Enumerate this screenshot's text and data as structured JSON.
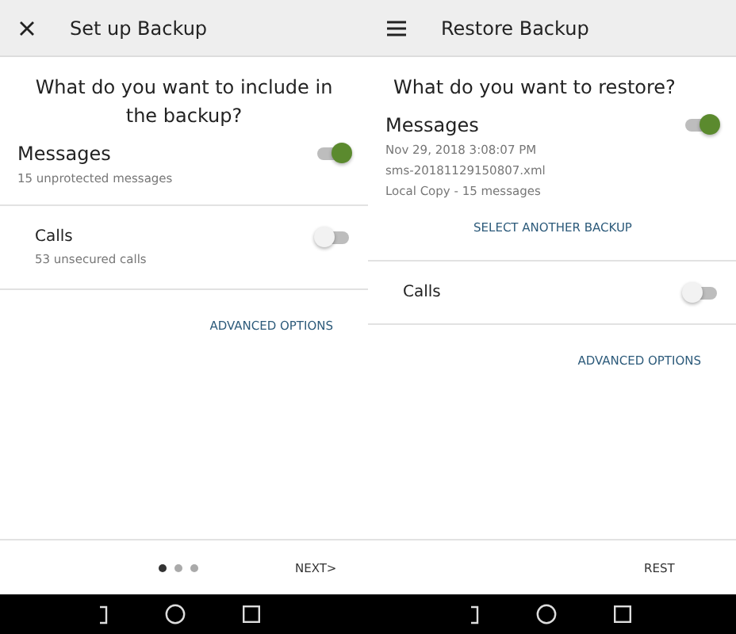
{
  "screens": [
    {
      "header": {
        "kind": "close",
        "title": "Set up Backup"
      },
      "question": "What do you want to include in the backup?",
      "items": [
        {
          "label": "Messages",
          "on": true,
          "details": [
            "15 unprotected messages"
          ]
        },
        {
          "label": "Calls",
          "on": false,
          "details": [
            "53 unsecured calls"
          ]
        }
      ],
      "advanced": "ADVANCED OPTIONS",
      "footer": {
        "dots": [
          {
            "selected": true
          },
          {
            "selected": false
          },
          {
            "selected": false
          }
        ],
        "next": "NEXT>"
      }
    },
    {
      "header": {
        "kind": "menu",
        "title": "Restore Backup"
      },
      "question": "What do you want to restore?",
      "items": [
        {
          "label": "Messages",
          "on": true,
          "details": [
            "Nov 29, 2018 3:08:07 PM",
            "sms-20181129150807.xml",
            "Local Copy - 15 messages"
          ],
          "link": "SELECT ANOTHER BACKUP"
        },
        {
          "label": "Calls",
          "on": false
        }
      ],
      "advanced": "ADVANCED OPTIONS",
      "footer": {
        "next": "REST"
      }
    }
  ]
}
